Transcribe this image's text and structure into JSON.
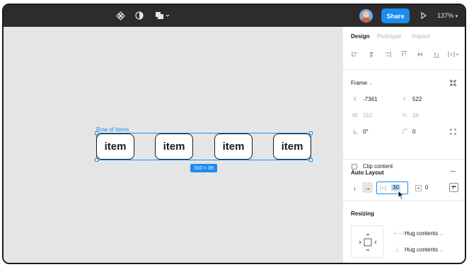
{
  "toolbar": {
    "share_label": "Share",
    "zoom_label": "137%",
    "icons": [
      "component-icon",
      "contrast-icon",
      "shapes-icon",
      "play-icon"
    ]
  },
  "canvas": {
    "frame_label": "Row of items",
    "items": [
      "item",
      "item",
      "item",
      "item"
    ],
    "dimensions": "310 × 39",
    "colors": {
      "selection": "#1b8cf0",
      "background": "#e5e5e5"
    }
  },
  "panel": {
    "tabs": [
      {
        "label": "Design",
        "active": true
      },
      {
        "label": "Prototype",
        "active": false
      },
      {
        "label": "Inspect",
        "active": false
      }
    ],
    "frame": {
      "title": "Frame",
      "x_label": "X",
      "x_value": "-7361",
      "y_label": "Y",
      "y_value": "522",
      "w_label": "W",
      "w_value": "310",
      "h_label": "H",
      "h_value": "39",
      "rotation_value": "0°",
      "radius_value": "0",
      "clip_label": "Clip content"
    },
    "auto_layout": {
      "title": "Auto Layout",
      "more_label": "—",
      "gap_value": "30",
      "padding_value": "0"
    },
    "resizing": {
      "title": "Resizing",
      "horizontal": "Hug contents",
      "vertical": "Hug contents"
    }
  }
}
